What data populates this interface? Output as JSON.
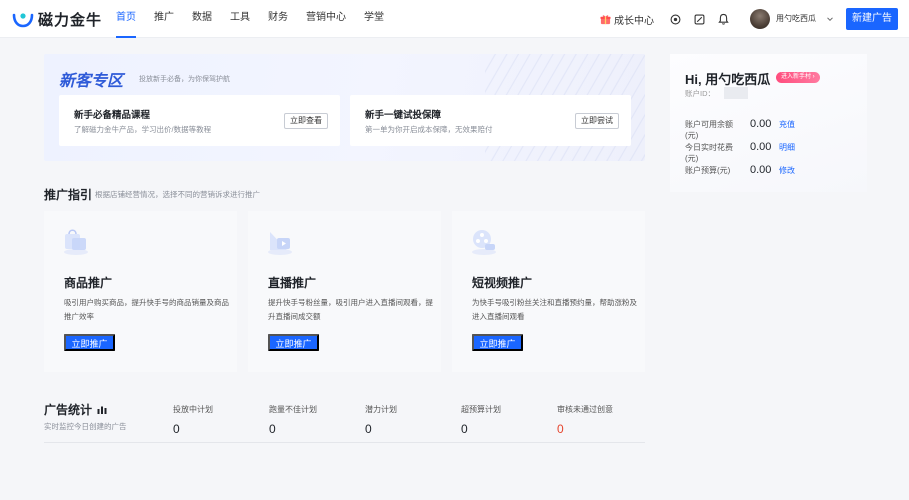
{
  "header": {
    "logo_text": "磁力金牛",
    "nav": [
      {
        "label": "首页",
        "active": true
      },
      {
        "label": "推广",
        "active": false
      },
      {
        "label": "数据",
        "active": false
      },
      {
        "label": "工具",
        "active": false
      },
      {
        "label": "财务",
        "active": false
      },
      {
        "label": "营销中心",
        "active": false
      },
      {
        "label": "学堂",
        "active": false
      }
    ],
    "growth_label": "成长中心",
    "user_name": "用勺吃西瓜",
    "user_id_prefix": "",
    "new_ad_label": "新建广告",
    "accent": "#1a66ff"
  },
  "banner": {
    "title": "新客专区",
    "subtitle": "投放新手必备，为你保驾护航",
    "boxes": [
      {
        "title": "新手必备精品课程",
        "desc": "了解磁力金牛产品，学习出价/数据等教程",
        "button": "立即查看"
      },
      {
        "title": "新手一键试投保障",
        "desc": "第一单为你开启成本保障，无效果赔付",
        "button": "立即尝试"
      }
    ]
  },
  "account": {
    "greeting": "Hi, 用勺吃西瓜",
    "tag": "进入新手村 ›",
    "id_label": "账户ID：",
    "rows": [
      {
        "label": "账户可用余额(元)",
        "value": "0.00",
        "link": "充值"
      },
      {
        "label": "今日实时花费(元)",
        "value": "0.00",
        "link": "明细"
      },
      {
        "label": "账户预算(元)",
        "value": "0.00",
        "link": "修改"
      }
    ]
  },
  "guide": {
    "title": "推广指引",
    "subtitle": "根据店铺经营情况，选择不同的营销诉求进行推广",
    "cards": [
      {
        "title": "商品推广",
        "desc": "吸引用户购买商品，提升快手号的商品销量及商品推广效率",
        "button": "立即推广",
        "icon": "shopping-bag-icon"
      },
      {
        "title": "直播推广",
        "desc": "提升快手号粉丝量，吸引用户进入直播间观看，提升直播间成交额",
        "button": "立即推广",
        "icon": "live-stream-icon"
      },
      {
        "title": "短视频推广",
        "desc": "为快手号吸引粉丝关注和直播预约量，帮助涨粉及进入直播间观看",
        "button": "立即推广",
        "icon": "video-reel-icon"
      }
    ]
  },
  "stats": {
    "title": "广告统计",
    "subtitle": "实时监控今日创建的广告",
    "items": [
      {
        "label": "投放中计划",
        "value": "0",
        "alert": false
      },
      {
        "label": "跑量不佳计划",
        "value": "0",
        "alert": false
      },
      {
        "label": "潜力计划",
        "value": "0",
        "alert": false
      },
      {
        "label": "超预算计划",
        "value": "0",
        "alert": false
      },
      {
        "label": "审核未通过创意",
        "value": "0",
        "alert": true
      }
    ]
  }
}
